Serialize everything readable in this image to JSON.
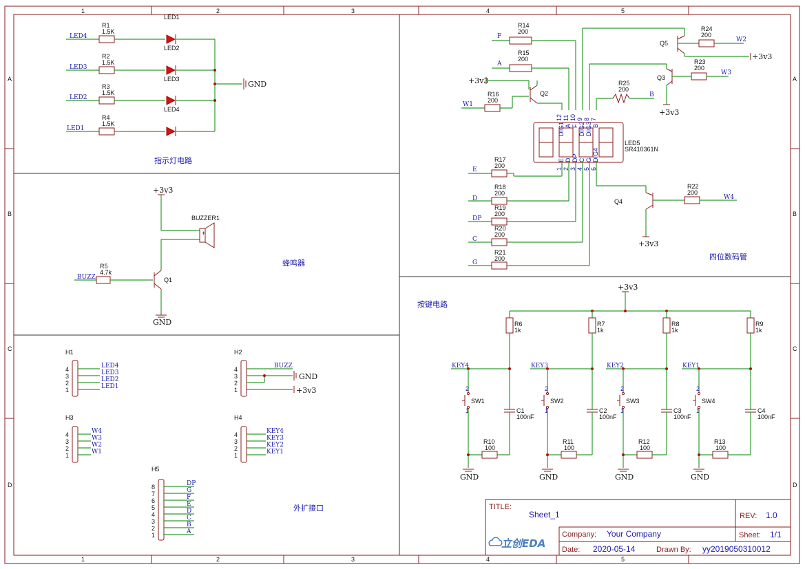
{
  "frame": {
    "columns": [
      "1",
      "2",
      "3",
      "4",
      "5"
    ],
    "rows": [
      "A",
      "B",
      "C",
      "D"
    ]
  },
  "sections": {
    "led_title": "指示灯电路",
    "buzzer_title": "蜂鸣器",
    "ext_title": "外扩接口",
    "digits_title": "四位数码管",
    "keys_title": "按键电路"
  },
  "led_circuit": {
    "rows": [
      {
        "net": "LED4",
        "res": "R1",
        "val": "1.5K",
        "led_top": "LED1",
        "led": "LED2"
      },
      {
        "net": "LED3",
        "res": "R2",
        "val": "1.5K",
        "led": "LED3"
      },
      {
        "net": "LED2",
        "res": "R3",
        "val": "1.5K",
        "led": "LED4"
      },
      {
        "net": "LED1",
        "res": "R4",
        "val": "1.5K",
        "led": ""
      }
    ],
    "gnd": "GND"
  },
  "buzzer": {
    "vcc": "+3v3",
    "name": "BUZZER1",
    "plus": "+",
    "res": "R5",
    "val": "4.7k",
    "net": "BUZZ",
    "q": "Q1",
    "gnd": "GND"
  },
  "headers": {
    "h1": {
      "name": "H1",
      "pins": [
        "4",
        "3",
        "2",
        "1"
      ],
      "nets": [
        "LED4",
        "LED3",
        "LED2",
        "LED1"
      ]
    },
    "h2": {
      "name": "H2",
      "pins": [
        "4",
        "3",
        "2",
        "1"
      ],
      "net": "BUZZ",
      "gnd": "GND",
      "vcc": "+3v3"
    },
    "h3": {
      "name": "H3",
      "pins": [
        "4",
        "3",
        "2",
        "1"
      ],
      "nets": [
        "W4",
        "W3",
        "W2",
        "W1"
      ]
    },
    "h4": {
      "name": "H4",
      "pins": [
        "4",
        "3",
        "2",
        "1"
      ],
      "nets": [
        "KEY4",
        "KEY3",
        "KEY2",
        "KEY1"
      ]
    },
    "h5": {
      "name": "H5",
      "pins": [
        "8",
        "7",
        "6",
        "5",
        "4",
        "3",
        "2",
        "1"
      ],
      "nets": [
        "DP",
        "G",
        "F",
        "E",
        "D",
        "C",
        "B",
        "A"
      ]
    }
  },
  "display": {
    "name": "LED5",
    "part": "SR410361N",
    "top_pins": [
      "12",
      "11",
      "10",
      "9",
      "8",
      "7"
    ],
    "top_labels": [
      "DIG1",
      "A",
      "F",
      "DIG2",
      "DIG3",
      "B"
    ],
    "bot_pins": [
      "1",
      "2",
      "3",
      "4",
      "5",
      "6"
    ],
    "bot_labels": [
      "E",
      "D",
      "DP",
      "C",
      "G",
      "DIG4"
    ],
    "res": [
      {
        "ref": "R14",
        "val": "200",
        "net": "F"
      },
      {
        "ref": "R15",
        "val": "200",
        "net": "A"
      },
      {
        "ref": "R16",
        "val": "200",
        "net": "W1"
      },
      {
        "ref": "R25",
        "val": "200",
        "net": "B"
      },
      {
        "ref": "R24",
        "val": "200",
        "net": "W2"
      },
      {
        "ref": "R23",
        "val": "200",
        "net": "W3"
      },
      {
        "ref": "R17",
        "val": "200",
        "net": "E"
      },
      {
        "ref": "R18",
        "val": "200",
        "net": "D"
      },
      {
        "ref": "R19",
        "val": "200",
        "net": "DP"
      },
      {
        "ref": "R20",
        "val": "200",
        "net": "C"
      },
      {
        "ref": "R21",
        "val": "200",
        "net": "G"
      },
      {
        "ref": "R22",
        "val": "200",
        "net": "W4"
      }
    ],
    "q2": "Q2",
    "q3": "Q3",
    "q4": "Q4",
    "q5": "Q5",
    "vcc": "+3v3"
  },
  "keys": {
    "vcc": "+3v3",
    "cols": [
      {
        "key": "KEY4",
        "sw": "SW1",
        "rpu": "R6",
        "rpu_val": "1k",
        "cap": "C1",
        "cap_val": "100nF",
        "rs": "R10",
        "rs_val": "100"
      },
      {
        "key": "KEY3",
        "sw": "SW2",
        "rpu": "R7",
        "rpu_val": "1k",
        "cap": "C2",
        "cap_val": "100nF",
        "rs": "R11",
        "rs_val": "100"
      },
      {
        "key": "KEY2",
        "sw": "SW3",
        "rpu": "R8",
        "rpu_val": "1k",
        "cap": "C3",
        "cap_val": "100nF",
        "rs": "R12",
        "rs_val": "100"
      },
      {
        "key": "KEY1",
        "sw": "SW4",
        "rpu": "R9",
        "rpu_val": "1k",
        "cap": "C4",
        "cap_val": "100nF",
        "rs": "R13",
        "rs_val": "100"
      }
    ],
    "pin1": "1",
    "pin2": "2",
    "gnd": "GND"
  },
  "title_block": {
    "title_label": "TITLE:",
    "title": "Sheet_1",
    "rev_label": "REV:",
    "rev": "1.0",
    "company_label": "Company:",
    "company": "Your Company",
    "sheet_label": "Sheet:",
    "sheet": "1/1",
    "date_label": "Date:",
    "date": "2020-05-14",
    "drawn_label": "Drawn By:",
    "drawn": "yy2019050310012",
    "logo": "立创EDA"
  }
}
